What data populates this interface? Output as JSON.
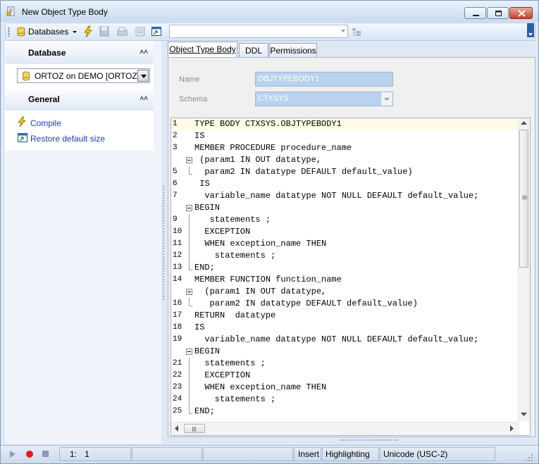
{
  "window": {
    "title": "New Object Type Body"
  },
  "toolbar": {
    "databases_label": "Databases"
  },
  "left_panel": {
    "database_section_title": "Database",
    "database_selected": "ORTOZ on DEMO [ORTOZ]",
    "general_section_title": "General",
    "compile_label": "Compile",
    "restore_label": "Restore default size"
  },
  "tabs": [
    {
      "label": "Object Type Body"
    },
    {
      "label": "DDL"
    },
    {
      "label": "Permissions"
    }
  ],
  "form": {
    "name_label": "Name",
    "name_value": "OBJTYPEBODY1",
    "schema_label": "Schema",
    "schema_value": "CTXSYS"
  },
  "editor": {
    "lines": [
      {
        "num": "1",
        "text": "TYPE BODY CTXSYS.OBJTYPEBODY1"
      },
      {
        "num": "2",
        "text": "IS"
      },
      {
        "num": "3",
        "text": "MEMBER PROCEDURE procedure_name"
      },
      {
        "num": "",
        "text": " (param1 IN OUT datatype,"
      },
      {
        "num": "5",
        "text": "  param2 IN datatype DEFAULT default_value)"
      },
      {
        "num": "6",
        "text": " IS"
      },
      {
        "num": "7",
        "text": "  variable_name datatype NOT NULL DEFAULT default_value;"
      },
      {
        "num": "",
        "text": "BEGIN"
      },
      {
        "num": "9",
        "text": "   statements ;"
      },
      {
        "num": "10",
        "text": "  EXCEPTION"
      },
      {
        "num": "11",
        "text": "  WHEN exception_name THEN"
      },
      {
        "num": "12",
        "text": "    statements ;"
      },
      {
        "num": "13",
        "text": "END;"
      },
      {
        "num": "14",
        "text": "MEMBER FUNCTION function_name"
      },
      {
        "num": "",
        "text": "  (param1 IN OUT datatype,"
      },
      {
        "num": "16",
        "text": "   param2 IN datatype DEFAULT default_value)"
      },
      {
        "num": "17",
        "text": "RETURN  datatype"
      },
      {
        "num": "18",
        "text": "IS"
      },
      {
        "num": "19",
        "text": "  variable_name datatype NOT NULL DEFAULT default_value;"
      },
      {
        "num": "",
        "text": "BEGIN"
      },
      {
        "num": "21",
        "text": "  statements ;"
      },
      {
        "num": "22",
        "text": "  EXCEPTION"
      },
      {
        "num": "23",
        "text": "  WHEN exception_name THEN"
      },
      {
        "num": "24",
        "text": "    statements ;"
      },
      {
        "num": "25",
        "text": "END;"
      }
    ],
    "vscroll_thumb_fraction": 0.45
  },
  "statusbar": {
    "position_line": "1:",
    "position_col": "1",
    "mode": "Insert",
    "highlighting": "Highlighting",
    "encoding": "Unicode (USC-2)"
  },
  "colors": {
    "accent": "#1a3fa8",
    "current_line": "#fefce6",
    "field_bg": "#b9d2ee"
  }
}
